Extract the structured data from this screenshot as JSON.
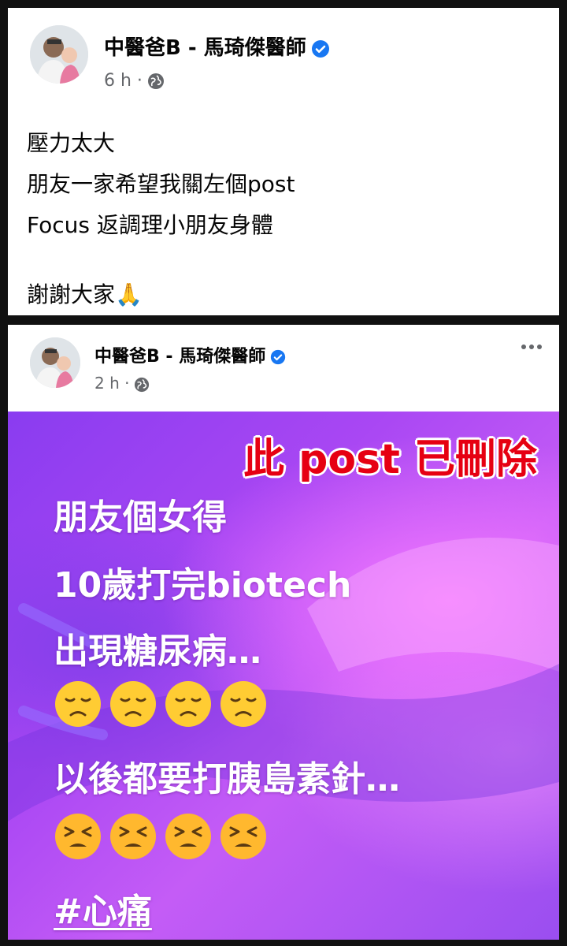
{
  "post1": {
    "author": "中醫爸B - 馬琦傑醫師",
    "time": "6 h ·",
    "lines": [
      "壓力太大",
      "朋友一家希望我關左個post",
      "Focus 返調理小朋友身體",
      "謝謝大家🙏"
    ]
  },
  "post2": {
    "author": "中醫爸B - 馬琦傑醫師",
    "time": "2 h ·",
    "deleted_label": "此 post 已刪除",
    "image_lines": [
      "朋友個女得",
      "10歲打完biotech",
      "出現糖尿病…",
      "以後都要打胰島素針…"
    ],
    "hashtag": "#心痛",
    "sad_emoji_count": 4,
    "tired_emoji_count": 4
  },
  "colors": {
    "verified": "#1877f2",
    "deleted_red": "#e60012",
    "meta_gray": "#65676b"
  }
}
